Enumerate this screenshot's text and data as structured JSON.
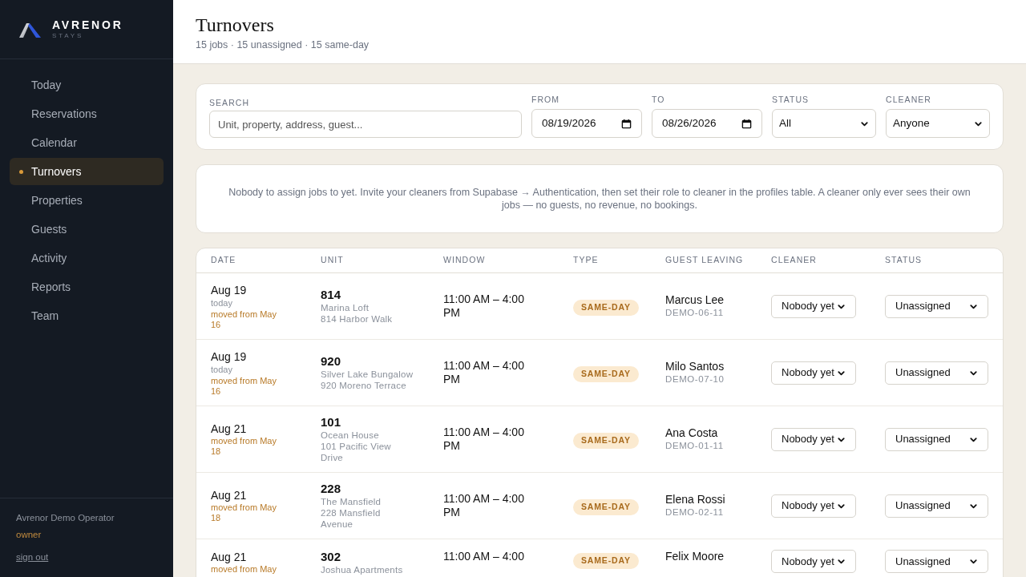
{
  "brand": {
    "name": "AVRENOR",
    "tagline": "STAYS"
  },
  "nav": [
    {
      "label": "Today",
      "selected": false
    },
    {
      "label": "Reservations",
      "selected": false
    },
    {
      "label": "Calendar",
      "selected": false
    },
    {
      "label": "Turnovers",
      "selected": true
    },
    {
      "label": "Properties",
      "selected": false
    },
    {
      "label": "Guests",
      "selected": false
    },
    {
      "label": "Activity",
      "selected": false
    },
    {
      "label": "Reports",
      "selected": false
    },
    {
      "label": "Team",
      "selected": false
    }
  ],
  "user": {
    "name": "Avrenor Demo Operator",
    "role": "owner",
    "sign_out": "sign out"
  },
  "page": {
    "title": "Turnovers",
    "summary": "15 jobs · 15 unassigned · 15 same-day"
  },
  "filters": {
    "search": {
      "label": "SEARCH",
      "placeholder": "Unit, property, address, guest..."
    },
    "from": {
      "label": "FROM",
      "value": "08/19/2026"
    },
    "to": {
      "label": "TO",
      "value": "08/26/2026"
    },
    "status": {
      "label": "STATUS",
      "value": "All"
    },
    "cleaner": {
      "label": "CLEANER",
      "value": "Anyone"
    }
  },
  "notice": "Nobody to assign jobs to yet. Invite your cleaners from Supabase → Authentication, then set their role to cleaner in the profiles table. A cleaner only ever sees their own jobs — no guests, no revenue, no bookings.",
  "table": {
    "columns": [
      "DATE",
      "UNIT",
      "WINDOW",
      "TYPE",
      "GUEST LEAVING",
      "CLEANER",
      "STATUS"
    ],
    "rows": [
      {
        "date": "Aug 19",
        "note": "today",
        "moved": "moved from May 16",
        "unit": "814",
        "property": "Marina Loft",
        "address": "814 Harbor Walk",
        "window": "11:00 AM – 4:00 PM",
        "type": "SAME-DAY",
        "guest": "Marcus Lee",
        "code": "DEMO-06-11",
        "cleaner": "Nobody yet",
        "status": "Unassigned"
      },
      {
        "date": "Aug 19",
        "note": "today",
        "moved": "moved from May 16",
        "unit": "920",
        "property": "Silver Lake Bungalow",
        "address": "920 Moreno Terrace",
        "window": "11:00 AM – 4:00 PM",
        "type": "SAME-DAY",
        "guest": "Milo Santos",
        "code": "DEMO-07-10",
        "cleaner": "Nobody yet",
        "status": "Unassigned"
      },
      {
        "date": "Aug 21",
        "moved": "moved from May 18",
        "unit": "101",
        "property": "Ocean House",
        "address": "101 Pacific View Drive",
        "window": "11:00 AM – 4:00 PM",
        "type": "SAME-DAY",
        "guest": "Ana Costa",
        "code": "DEMO-01-11",
        "cleaner": "Nobody yet",
        "status": "Unassigned"
      },
      {
        "date": "Aug 21",
        "moved": "moved from May 18",
        "unit": "228",
        "property": "The Mansfield",
        "address": "228 Mansfield Avenue",
        "window": "11:00 AM – 4:00 PM",
        "type": "SAME-DAY",
        "guest": "Elena Rossi",
        "code": "DEMO-02-11",
        "cleaner": "Nobody yet",
        "status": "Unassigned"
      },
      {
        "date": "Aug 21",
        "moved": "moved from May",
        "unit": "302",
        "property": "Joshua Apartments",
        "window": "11:00 AM – 4:00",
        "type": "SAME-DAY",
        "guest": "Felix Moore",
        "cleaner": "Nobody yet",
        "status": "Unassigned"
      }
    ]
  }
}
